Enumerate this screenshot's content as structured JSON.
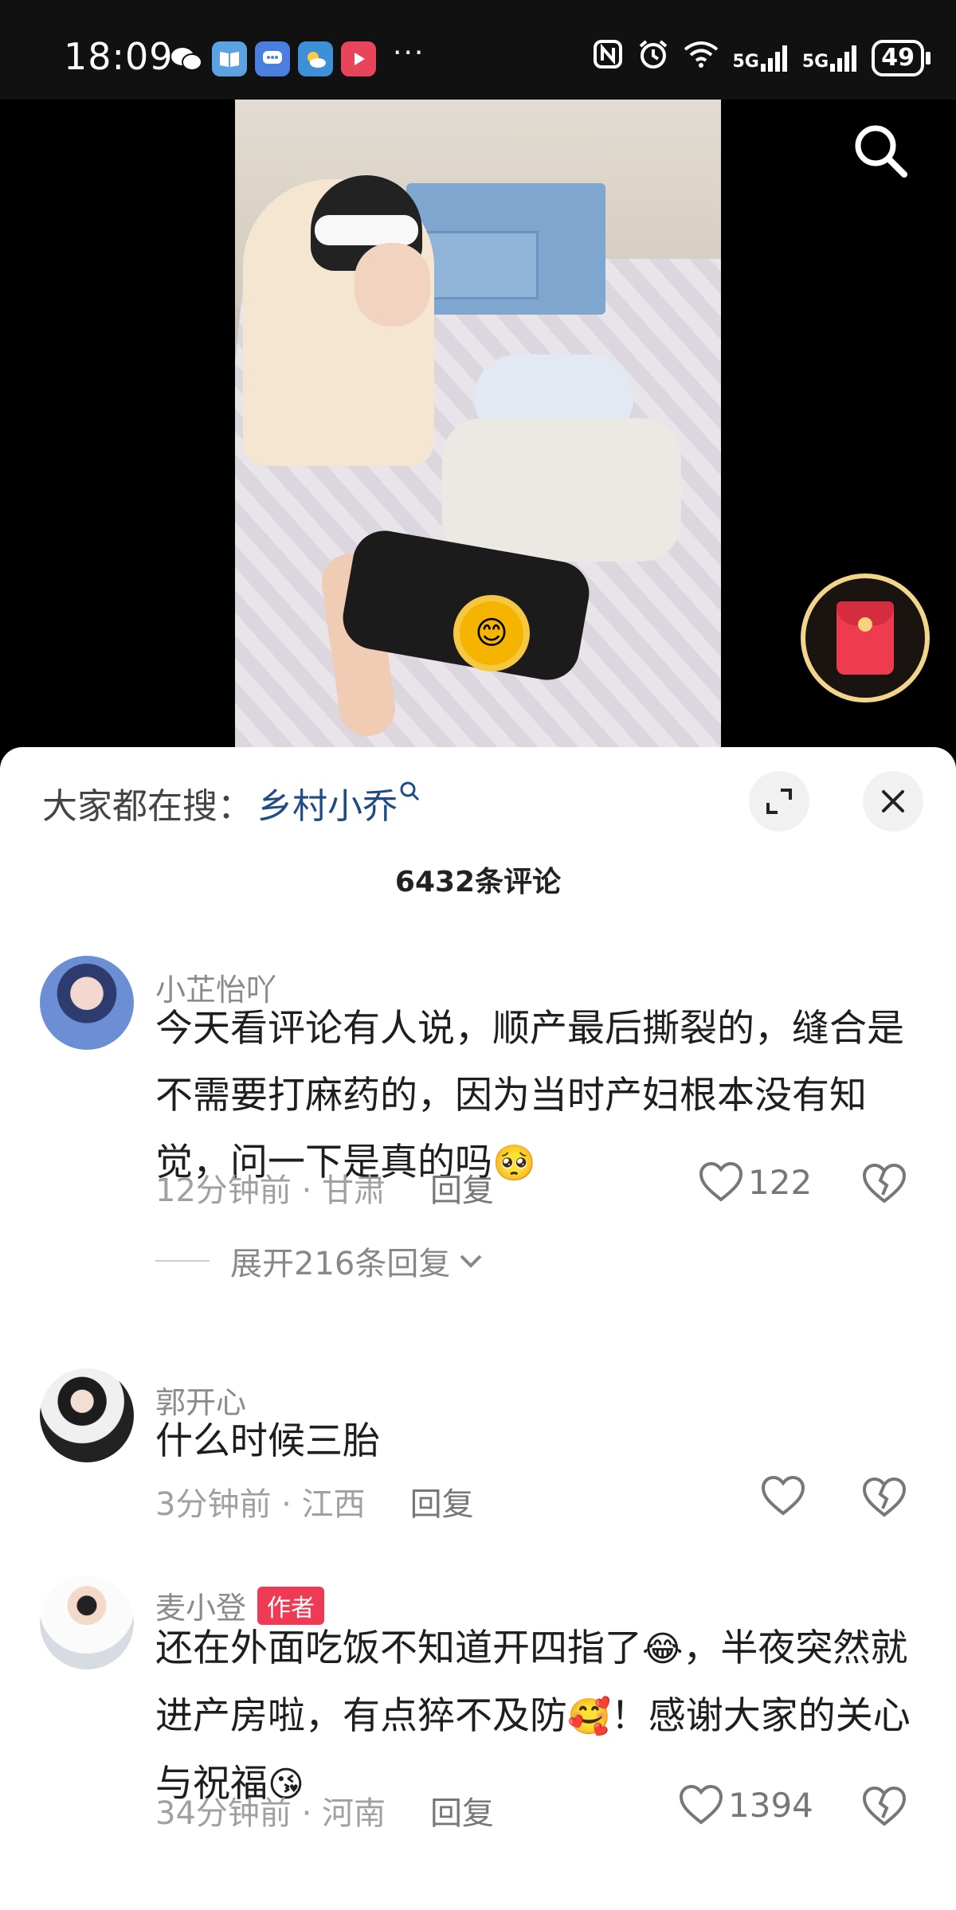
{
  "status_bar": {
    "time": "18:09",
    "signal_1": "5G",
    "signal_2": "5G",
    "battery": "49"
  },
  "video": {
    "search_icon": "search-icon",
    "red_packet_icon": "red-envelope-icon"
  },
  "sheet": {
    "hot_search_label": "大家都在搜：",
    "hot_search_term": "乡村小乔",
    "comment_count": "6432条评论",
    "expand_icon": "expand-icon",
    "close_icon": "close-icon"
  },
  "comments": [
    {
      "name": "小芷怡吖",
      "text": "今天看评论有人说，顺产最后撕裂的，缝合是不需要打麻药的，因为当时产妇根本没有知觉，问一下是真的吗",
      "emoji": "🥺",
      "meta": "12分钟前 · 甘肃",
      "reply": "回复",
      "likes": "122",
      "expand_replies": "展开216条回复"
    },
    {
      "name": "郭开心",
      "text": "什么时候三胎",
      "meta": "3分钟前 · 江西",
      "reply": "回复",
      "likes": ""
    },
    {
      "name": "麦小登",
      "author_tag": "作者",
      "text_part1": "还在外面吃饭不知道开四指了",
      "emoji1": "😂",
      "text_part2": "，半夜突然就进产房啦，有点猝不及防",
      "emoji2": "🥰",
      "text_part3": "！感谢大家的关心与祝福",
      "emoji3": "😘",
      "meta": "34分钟前 · 河南",
      "reply": "回复",
      "likes": "1394"
    }
  ]
}
